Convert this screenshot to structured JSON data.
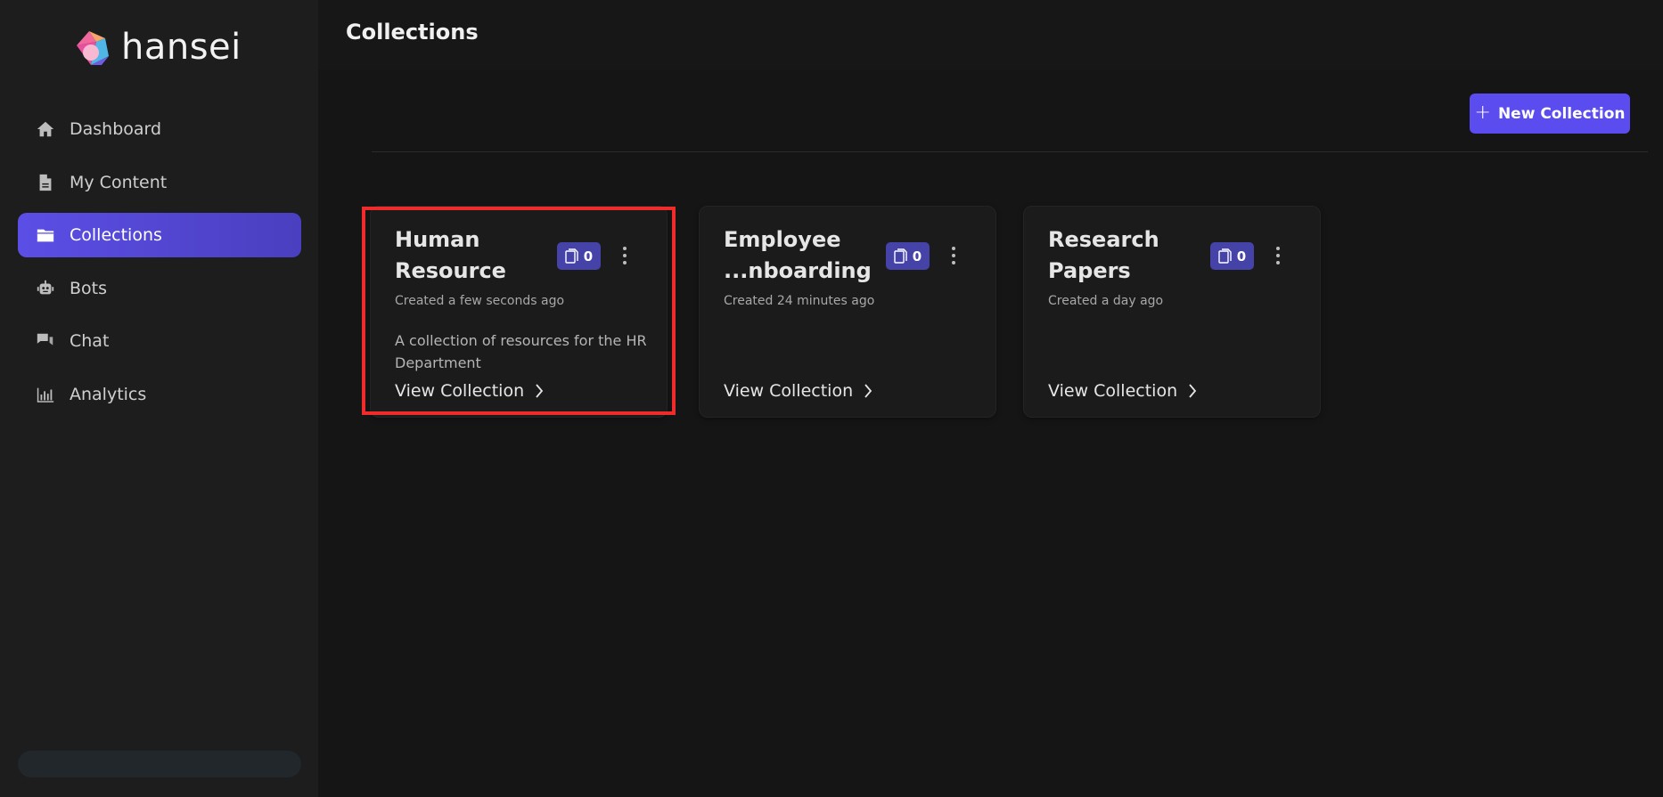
{
  "brand": {
    "name": "hansei",
    "accent": "#5b4cf0"
  },
  "sidebar": {
    "items": [
      {
        "label": "Dashboard",
        "icon": "home-icon",
        "active": false
      },
      {
        "label": "My Content",
        "icon": "document-icon",
        "active": false
      },
      {
        "label": "Collections",
        "icon": "folder-icon",
        "active": true
      },
      {
        "label": "Bots",
        "icon": "robot-icon",
        "active": false
      },
      {
        "label": "Chat",
        "icon": "chat-icon",
        "active": false
      },
      {
        "label": "Analytics",
        "icon": "bar-chart-icon",
        "active": false
      }
    ]
  },
  "header": {
    "title": "Collections"
  },
  "toolbar": {
    "new_collection_label": "New Collection",
    "new_collection_icon": "plus-icon"
  },
  "collections": [
    {
      "title": "Human Resource",
      "doc_count": "0",
      "created": "Created a few seconds ago",
      "description": "A collection of resources for the HR Department",
      "link_label": "View Collection",
      "highlighted": true
    },
    {
      "title": "Employee ...nboarding",
      "doc_count": "0",
      "created": "Created 24 minutes ago",
      "description": "",
      "link_label": "View Collection",
      "highlighted": false
    },
    {
      "title": "Research Papers",
      "doc_count": "0",
      "created": "Created a day ago",
      "description": "",
      "link_label": "View Collection",
      "highlighted": false
    }
  ],
  "colors": {
    "sidebar_bg": "#1d1d1d",
    "main_bg": "#151515",
    "active_nav": "#5b4ee6",
    "badge_bg": "#4542a8",
    "highlight_border": "#ee2c2c"
  }
}
